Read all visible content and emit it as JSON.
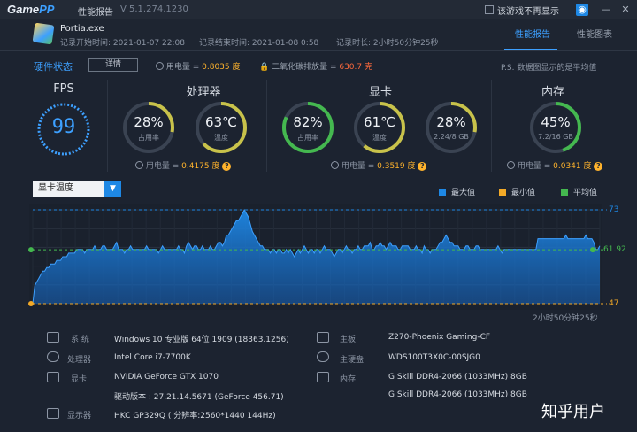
{
  "titlebar": {
    "brand_a": "Game",
    "brand_b": "PP",
    "title": "性能报告",
    "version": "V 5.1.274.1230",
    "hide_checkbox": "该游戏不再显示"
  },
  "header": {
    "app_name": "Portia.exe",
    "start_time": "记录开始时间: 2021-01-07 22:08",
    "end_time": "记录结束时间: 2021-01-08 0:58",
    "duration": "记录时长: 2小时50分钟25秒",
    "tabs": [
      {
        "label": "性能报告",
        "active": true
      },
      {
        "label": "性能图表",
        "active": false
      }
    ]
  },
  "hardware": {
    "title": "硬件状态",
    "details_button": "详情",
    "power_label": "用电量 = ",
    "power_value": "0.8035 度",
    "co2_label": "二氧化碳排放量 = ",
    "co2_value": "630.7 克",
    "note": "P.S. 数据图显示的是平均值"
  },
  "fps": {
    "title": "FPS",
    "value": "99"
  },
  "cpu": {
    "title": "处理器",
    "usage": {
      "value": "28%",
      "label": "占用率",
      "pct": 28
    },
    "temp": {
      "value": "63℃",
      "label": "温度",
      "pct": 63
    },
    "power_label": "用电量 = ",
    "power_value": "0.4175 度"
  },
  "gpu": {
    "title": "显卡",
    "usage": {
      "value": "82%",
      "label": "占用率",
      "pct": 82
    },
    "temp": {
      "value": "61℃",
      "label": "温度",
      "pct": 61
    },
    "vram": {
      "value": "28%",
      "label": "2.24/8 GB",
      "pct": 28
    },
    "power_label": "用电量 = ",
    "power_value": "0.3519 度"
  },
  "memory": {
    "title": "内存",
    "usage": {
      "value": "45%",
      "label": "7.2/16 GB",
      "pct": 45
    },
    "power_label": "用电量 = ",
    "power_value": "0.0341 度"
  },
  "colors": {
    "accent": "#3da0ff",
    "max": "#1e88e5",
    "min": "#f2a927",
    "avg": "#44b84f",
    "warn": "#ffb32c"
  },
  "chart": {
    "select_label": "显卡温度",
    "legend": [
      "最大值",
      "最小值",
      "平均值"
    ],
    "max_label": "73",
    "avg_label": "61.92",
    "min_label": "47",
    "time_label": "2小时50分钟25秒"
  },
  "chart_data": {
    "type": "area",
    "ylim": [
      47,
      73
    ],
    "series": [
      {
        "name": "最大值",
        "values": [
          47,
          52,
          53,
          54,
          55,
          56,
          56,
          57,
          57,
          58,
          58,
          58,
          59,
          59,
          59,
          60,
          60,
          60,
          61,
          61,
          61,
          61,
          62,
          62,
          62,
          62,
          61,
          62,
          62,
          62,
          62,
          63,
          62,
          62,
          62,
          63,
          63,
          62,
          62,
          62,
          62,
          63,
          64,
          62,
          62,
          62,
          61,
          62,
          62,
          63,
          62,
          62,
          62,
          62,
          62,
          62,
          62,
          63,
          62,
          62,
          62,
          62,
          62,
          61,
          62,
          63,
          62,
          62,
          62,
          62,
          62,
          62,
          62,
          63,
          62,
          62,
          61,
          63,
          64,
          63,
          62,
          63,
          63,
          62,
          62,
          63,
          62,
          62,
          62,
          63,
          62,
          62,
          63,
          64,
          64,
          63,
          64,
          66,
          66,
          67,
          68,
          69,
          70,
          70,
          71,
          72,
          73,
          72,
          71,
          69,
          67,
          66,
          65,
          64,
          63,
          63,
          62,
          62,
          62,
          61,
          62,
          62,
          61,
          62,
          62,
          61,
          61,
          62,
          61,
          62,
          61,
          60,
          61,
          62,
          61,
          62,
          63,
          62,
          61,
          62,
          62,
          61,
          62,
          62,
          61,
          62,
          63,
          62,
          62,
          62,
          61,
          60,
          61,
          62,
          62,
          61,
          62,
          63,
          62,
          62,
          61,
          62,
          62,
          63,
          62,
          62,
          63,
          63,
          63,
          64,
          62,
          62,
          63,
          63,
          64,
          63,
          63,
          62,
          63,
          64,
          63,
          63,
          63,
          62,
          62,
          63,
          63,
          63,
          63,
          62,
          62,
          62,
          63,
          62,
          62,
          61,
          63,
          62,
          62,
          61,
          62,
          62,
          62,
          63,
          64,
          64,
          65,
          66,
          65,
          64,
          64,
          63,
          63,
          63,
          62,
          62,
          62,
          63,
          63,
          62,
          62,
          62,
          63,
          63,
          62,
          62,
          62,
          62,
          62,
          62,
          62,
          62,
          62,
          63,
          62,
          61,
          62,
          62,
          62,
          62,
          62,
          62,
          62,
          62,
          62,
          62,
          62,
          62,
          62,
          62,
          62,
          62,
          62,
          65,
          65,
          65,
          65,
          65,
          65,
          65,
          65,
          65,
          65,
          65,
          65,
          65,
          65,
          66,
          65,
          65,
          65,
          65,
          65,
          65,
          65,
          65,
          65,
          66,
          65,
          65,
          65,
          64,
          62,
          62,
          63
        ]
      }
    ]
  },
  "system": {
    "os": {
      "label": "系  统",
      "value": "Windows 10 专业版 64位   1909 (18363.1256)"
    },
    "cpu": {
      "label": "处理器",
      "value": "Intel Core i7-7700K"
    },
    "gpu": {
      "label": "显卡",
      "value": "NVIDIA GeForce GTX 1070",
      "driver": "驱动版本 : 27.21.14.5671 (GeForce 456.71)"
    },
    "display": {
      "label": "显示器",
      "value": "HKC GP329Q ( 分辨率:2560*1440 144Hz)"
    },
    "board": {
      "label": "主板",
      "value": "Z270-Phoenix Gaming-CF"
    },
    "disk": {
      "label": "主硬盘",
      "value": "WDS100T3X0C-00SJG0"
    },
    "ram": {
      "label": "内存",
      "value1": "G Skill DDR4-2066 (1033MHz) 8GB",
      "value2": "G Skill DDR4-2066 (1033MHz) 8GB"
    }
  },
  "watermark": "知乎用户"
}
